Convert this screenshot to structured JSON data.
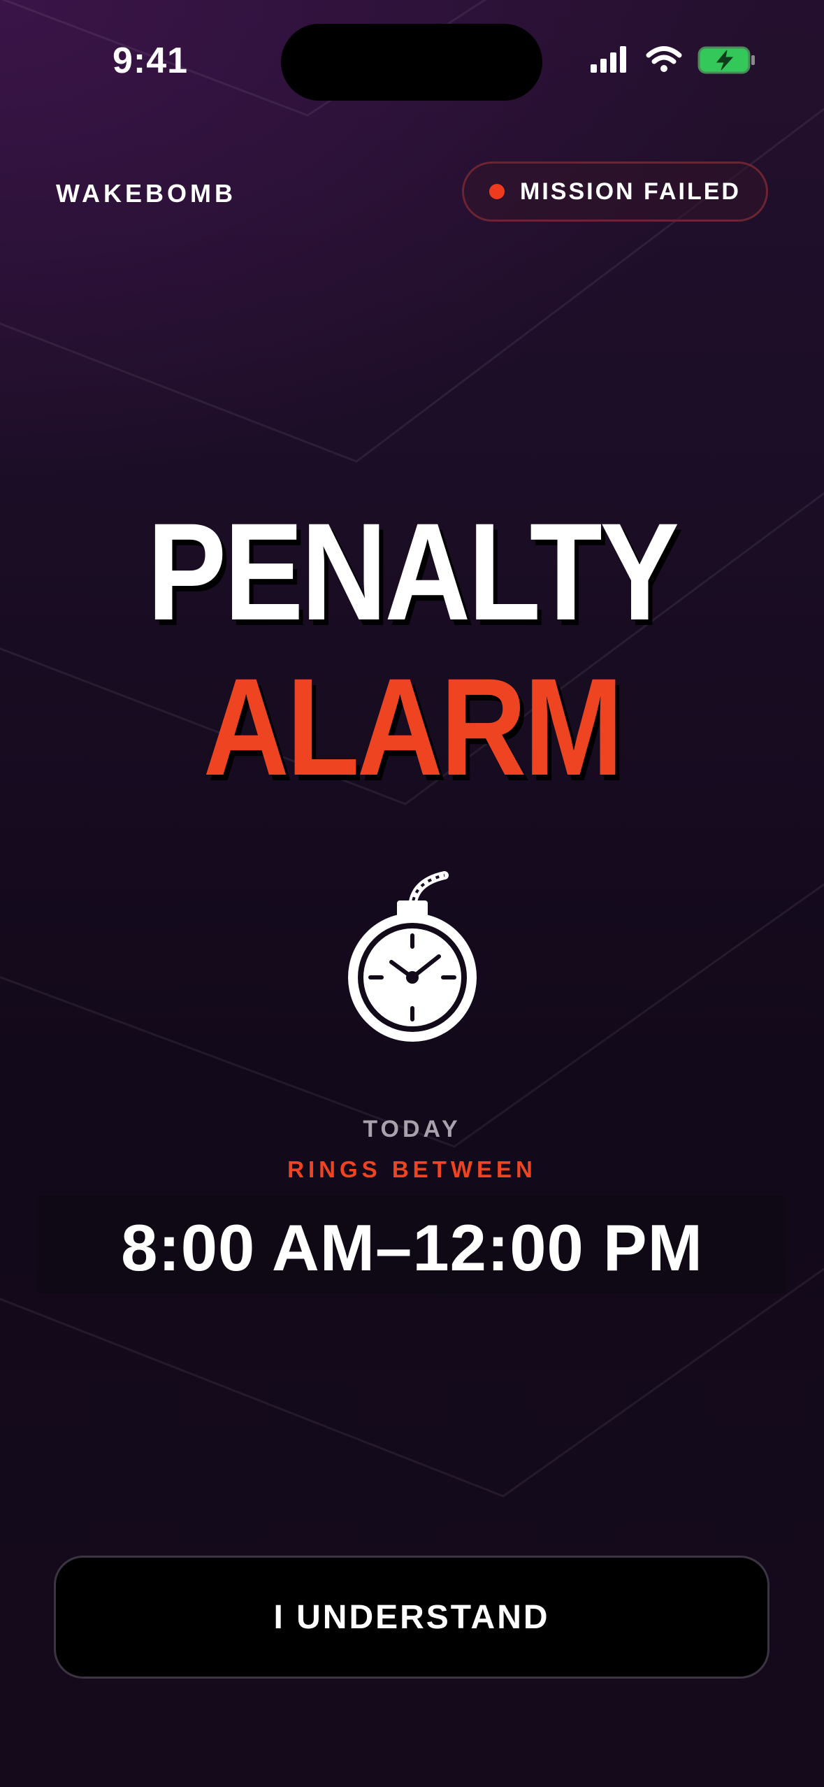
{
  "status_bar": {
    "time": "9:41",
    "icons": [
      "cellular-signal-icon",
      "wifi-icon",
      "battery-charging-icon"
    ],
    "battery_color": "#34c759"
  },
  "header": {
    "brand": "WAKEBOMB",
    "status_badge": {
      "label": "MISSION FAILED",
      "dot_color": "#ee3a1e"
    }
  },
  "title": {
    "line1": "PENALTY",
    "line2": "ALARM",
    "line2_color": "#ee4422"
  },
  "illustration": {
    "icon": "bomb-clock-icon"
  },
  "schedule": {
    "day_label": "TODAY",
    "rings_label": "RINGS BETWEEN",
    "time_range": "8:00 AM–12:00 PM"
  },
  "actions": {
    "confirm_label": "I UNDERSTAND"
  },
  "colors": {
    "accent": "#ee4422",
    "background": "#140b1c"
  }
}
